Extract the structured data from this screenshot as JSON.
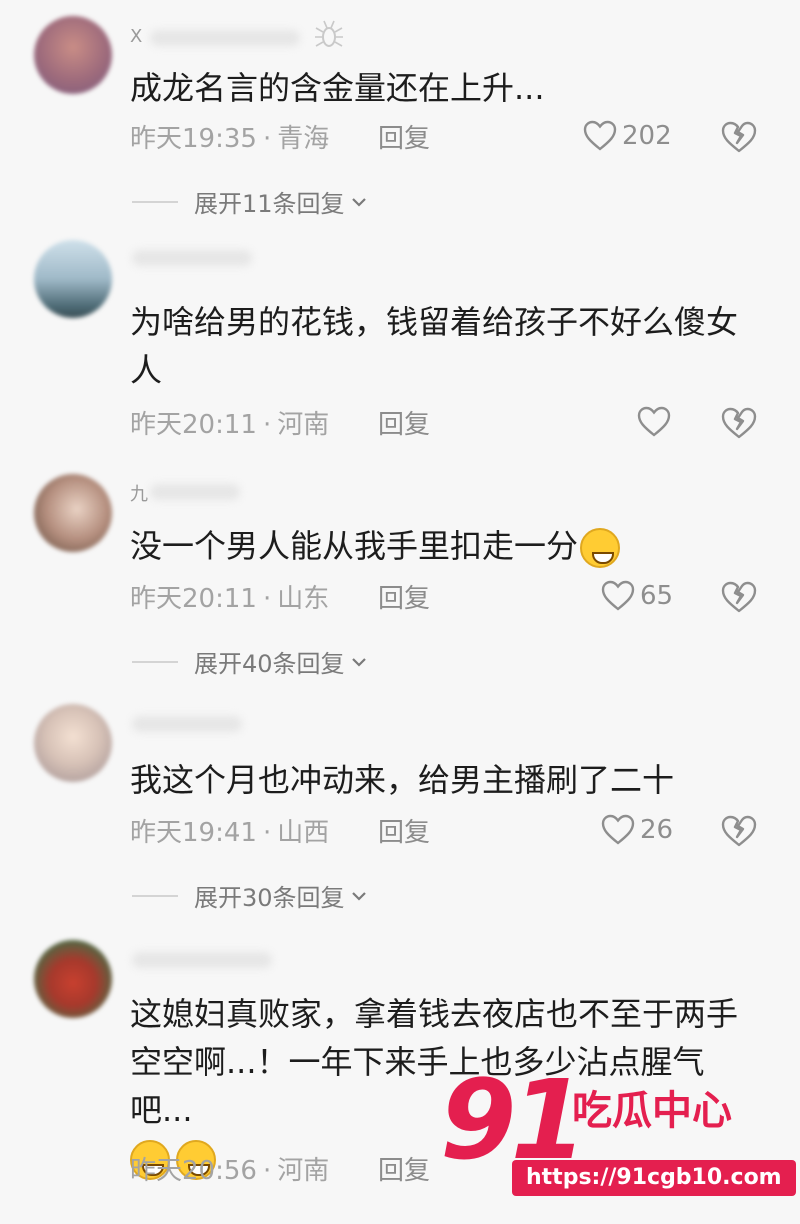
{
  "comments": [
    {
      "name": "X",
      "text": "成龙名言的含金量还在上升...",
      "time": "昨天19:35",
      "location": "青海",
      "reply": "回复",
      "likes": "202",
      "expand": "展开11条回复"
    },
    {
      "name": "",
      "text": "为啥给男的花钱，钱留着给孩子不好么傻女人",
      "time": "昨天20:11",
      "location": "河南",
      "reply": "回复",
      "likes": ""
    },
    {
      "name": "九",
      "text": "没一个男人能从我手里扣走一分",
      "time": "昨天20:11",
      "location": "山东",
      "reply": "回复",
      "likes": "65",
      "expand": "展开40条回复"
    },
    {
      "name": "",
      "text": "我这个月也冲动来，给男主播刷了二十",
      "time": "昨天19:41",
      "location": "山西",
      "reply": "回复",
      "likes": "26",
      "expand": "展开30条回复"
    },
    {
      "name": "",
      "text": "这媳妇真败家，拿着钱去夜店也不至于两手空空啊...！一年下来手上也多少沾点腥气吧...",
      "time": "昨天20:56",
      "location": "河南",
      "reply": "回复",
      "likes": ""
    }
  ],
  "separator": "·",
  "watermark": {
    "number": "91",
    "title": "吃瓜中心",
    "url": "https://91cgb10.com"
  },
  "colors": {
    "accent": "#e41f4f",
    "meta": "#a3a3a3",
    "text": "#1d1d1d"
  }
}
